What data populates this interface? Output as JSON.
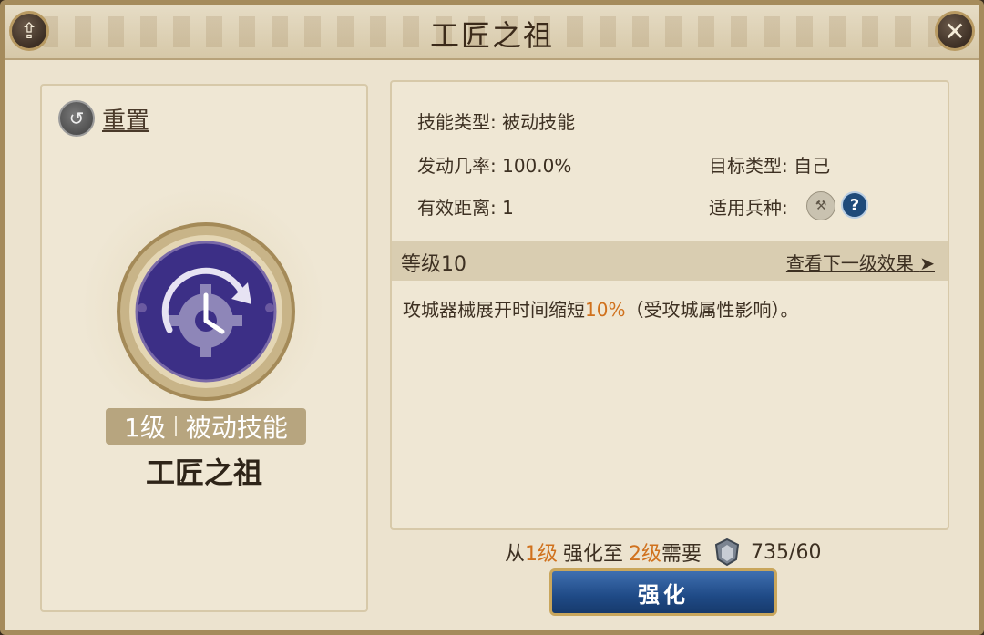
{
  "header": {
    "title": "工匠之祖"
  },
  "left": {
    "reset_label": "重置",
    "level": "1级",
    "skill_kind": "被动技能",
    "skill_name": "工匠之祖"
  },
  "info": {
    "skill_type_label": "技能类型:",
    "skill_type_value": "被动技能",
    "trigger_rate_label": "发动几率:",
    "trigger_rate_value": "100.0%",
    "target_type_label": "目标类型:",
    "target_type_value": "自己",
    "range_label": "有效距离:",
    "range_value": "1",
    "unit_type_label": "适用兵种:"
  },
  "level_section": {
    "level_label": "等级10",
    "next_level_link": "查看下一级效果"
  },
  "effect": {
    "prefix": "攻城器械展开时间缩短",
    "value": "10%",
    "suffix": "（受攻城属性影响）。"
  },
  "upgrade": {
    "from_text": "从",
    "from_level": "1级",
    "mid_text": "强化至",
    "to_level": "2级",
    "need_text": "需要",
    "cost": "735/60",
    "button_label": "强化"
  },
  "colors": {
    "highlight": "#d0711d",
    "button_blue": "#1f4a86",
    "frame_gold": "#a58b5c"
  }
}
